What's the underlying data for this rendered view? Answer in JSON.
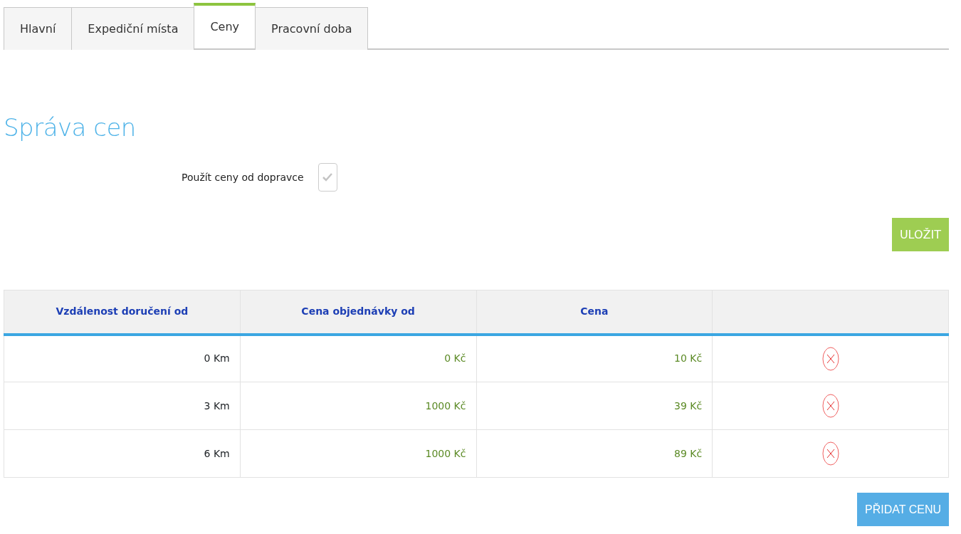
{
  "tabs": [
    {
      "label": "Hlavní",
      "selected": false
    },
    {
      "label": "Expediční místa",
      "selected": false
    },
    {
      "label": "Ceny",
      "selected": true
    },
    {
      "label": "Pracovní doba",
      "selected": false
    }
  ],
  "heading": "Správa cen",
  "carrier_prices": {
    "label": "Použít ceny od dopravce",
    "checked": true
  },
  "save_button": "ULOŽIT",
  "table": {
    "columns": [
      "Vzdálenost doručení od",
      "Cena objednávky od",
      "Cena"
    ],
    "rows": [
      {
        "distance": "0 Km",
        "order_from": "0 Kč",
        "price": "10 Kč"
      },
      {
        "distance": "3 Km",
        "order_from": "1000 Kč",
        "price": "39 Kč"
      },
      {
        "distance": "6 Km",
        "order_from": "1000 Kč",
        "price": "89 Kč"
      }
    ]
  },
  "add_button": "PŘIDAT CENU"
}
